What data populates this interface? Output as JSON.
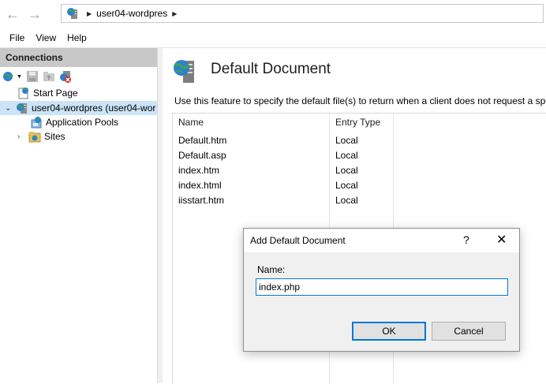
{
  "nav": {
    "back_icon": "back-arrow-icon",
    "forward_icon": "forward-arrow-icon",
    "breadcrumb": [
      "user04-wordpres"
    ]
  },
  "menu": [
    "File",
    "View",
    "Help"
  ],
  "connections": {
    "header": "Connections",
    "toolbar_icons": [
      "connect-icon",
      "save-icon",
      "folder-up-icon",
      "disconnect-icon"
    ],
    "tree": {
      "start_page": "Start Page",
      "server": "user04-wordpres (user04-wor",
      "app_pools": "Application Pools",
      "sites": "Sites"
    }
  },
  "main": {
    "title": "Default Document",
    "description": "Use this feature to specify the default file(s) to return when a client does not request a spe",
    "columns": [
      "Name",
      "Entry Type"
    ],
    "rows": [
      {
        "name": "Default.htm",
        "type": "Local"
      },
      {
        "name": "Default.asp",
        "type": "Local"
      },
      {
        "name": "index.htm",
        "type": "Local"
      },
      {
        "name": "index.html",
        "type": "Local"
      },
      {
        "name": "iisstart.htm",
        "type": "Local"
      }
    ]
  },
  "dialog": {
    "title": "Add Default Document",
    "help": "?",
    "close": "✕",
    "label": "Name:",
    "value": "index.php",
    "ok": "OK",
    "cancel": "Cancel"
  },
  "colors": {
    "accent": "#0078d7",
    "selection": "#cce4f7",
    "pane_header": "#c8c8c8"
  }
}
